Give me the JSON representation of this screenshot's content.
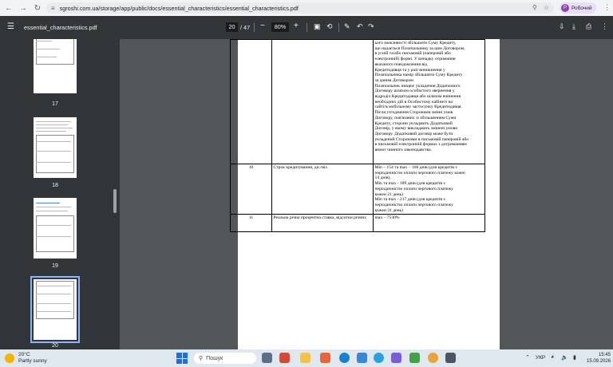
{
  "browser": {
    "url": "sgroshi.com.ua/storage/app/public/docs/essential_characteristics/essential_characteristics.pdf",
    "profile_initial": "Р",
    "profile_name": "Робочий"
  },
  "pdf_toolbar": {
    "file_name": "essential_characteristics.pdf",
    "current_page": "20",
    "total_pages": "/ 47",
    "zoom": "80%"
  },
  "sidebar": {
    "thumbnails": [
      {
        "label": "17"
      },
      {
        "label": "18"
      },
      {
        "label": "19"
      },
      {
        "label": "20"
      }
    ]
  },
  "document": {
    "row_cont": {
      "lines": [
        "ього можливості збільшити Суму Кредиту,",
        "що надається Позичальнику за цим Договором,",
        "в усній та/або письмовій (паперовій або",
        "електронній) формі. У випадку отримання",
        "вказаного повідомлення від",
        "Кредитодавця та у разі виникнення у",
        "Позичальника намір збільшити Суму Кредиту",
        "за даним Договором",
        "Позичальник іницює укладення Додаткового",
        "Договору шляхом особистого звернення у",
        "відрoділ Кредитодавця або шляхом вчинення",
        "необхідних дій в Особистому кабінеті на",
        "сайті/в мобільному застосунку Кредитодавця.",
        "Після узгодження Сторонами зміни умов",
        "Договору, пов'язаних зі збільшенням Суми",
        "Кредиту, сторони укладають Додатковий",
        "Договір, у якому викладають змінені умови",
        "Договору. Додатковий договір може бути",
        "укладений Сторонами в письмовій паперовій або",
        "в письмовій електронній формах з дотриманням",
        "вимог чинного законодавства."
      ]
    },
    "row10": {
      "num": "10",
      "name": "Строк кредитування, дн./міс.",
      "lines": [
        "Min – 154 та max – 168 днів (для кредитів з",
        "періодичністю оплати чергового платежу кожні",
        "14 днів),",
        "Min та max - 189 днів (для кредитів з",
        "періодичністю оплати чергового платежу",
        "кожен 21 день)",
        "Min та max - 217 днів (для кредитів з",
        "періодичністю оплати чергового платежу",
        "кожен 31 день)"
      ]
    },
    "row11": {
      "num": "11",
      "name": "Реальна річна процентна ставка, відсотки річних",
      "value": "max – 7530%"
    }
  },
  "taskbar": {
    "temperature": "20°C",
    "weather_text": "Partly sunny",
    "search_placeholder": "Пошук",
    "language": "УКР",
    "time": "15:45",
    "date": "15.09.2026"
  }
}
